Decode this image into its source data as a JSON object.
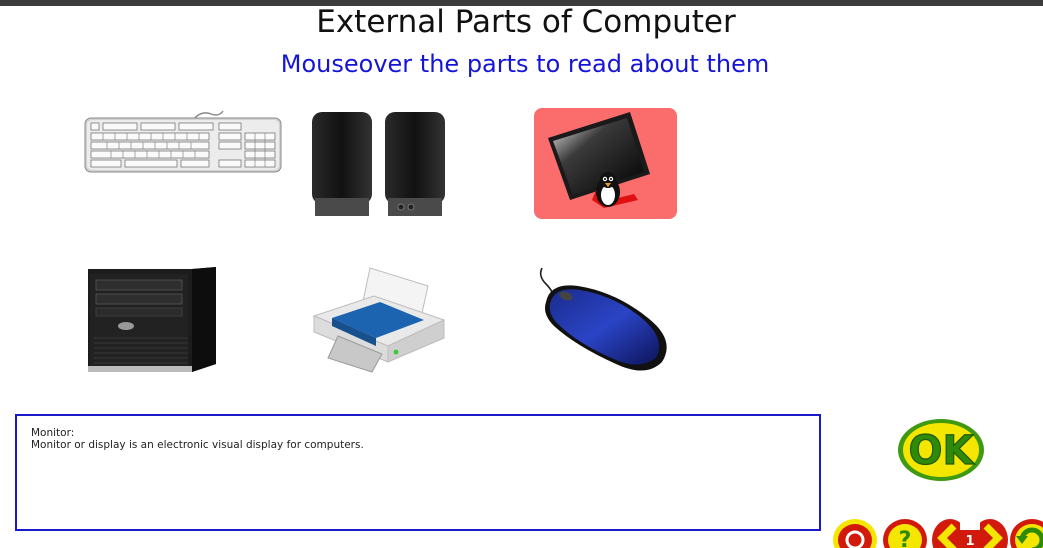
{
  "header": {
    "title": "External Parts of Computer",
    "subtitle": "Mouseover the parts to read about them"
  },
  "parts": [
    {
      "name": "Keyboard",
      "icon": "keyboard-icon"
    },
    {
      "name": "Speakers",
      "icon": "speakers-icon"
    },
    {
      "name": "Monitor",
      "icon": "monitor-icon",
      "selected": true
    },
    {
      "name": "CPU Cabinet",
      "icon": "cpu-tower-icon"
    },
    {
      "name": "Printer",
      "icon": "printer-icon"
    },
    {
      "name": "Mouse",
      "icon": "mouse-icon"
    }
  ],
  "info": {
    "title": "Monitor:",
    "text": "Monitor or display is an electronic visual display for computers."
  },
  "controls": {
    "ok_label": "OK",
    "page_number": "1"
  },
  "colors": {
    "subtitle": "#1515d6",
    "selected_bg": "#fb6c6c",
    "box_border": "#1a1acc",
    "ok_yellow": "#f5e600",
    "ok_green": "#3f9a12",
    "nav_red": "#d11a0c"
  }
}
